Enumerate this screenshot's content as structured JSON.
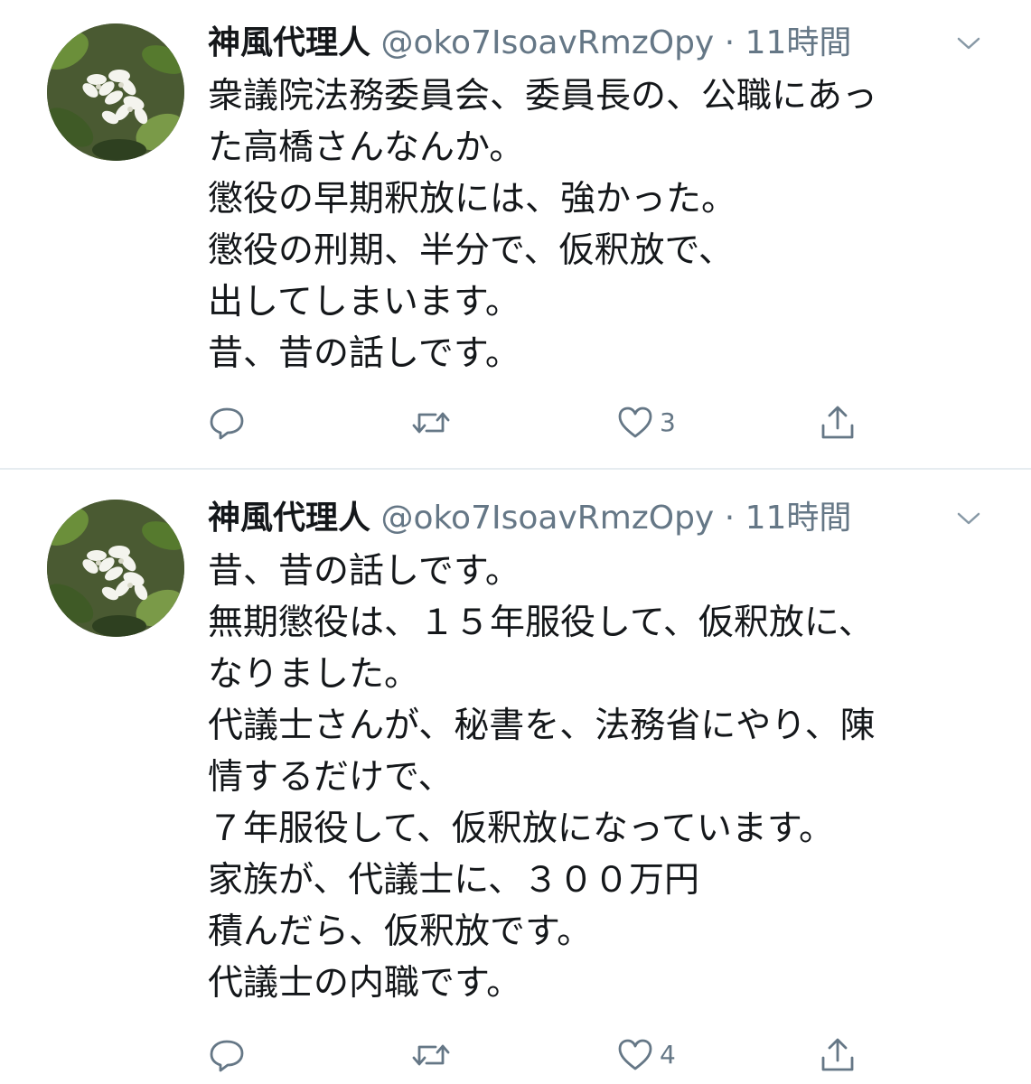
{
  "tweets": [
    {
      "display_name": "神風代理人",
      "handle": "@oko7IsoavRmzOpy",
      "separator": "·",
      "time": "11時間",
      "avatar_icon": "flower-avatar-icon",
      "lines": [
        "衆議院法務委員会、委員長の、公職にあっ",
        "た高橋さんなんか。",
        "懲役の早期釈放には、強かった。",
        "懲役の刑期、半分で、仮釈放で、",
        "出してしまいます。",
        "昔、昔の話しです。"
      ],
      "actions": {
        "reply_icon": "reply-icon",
        "retweet_icon": "retweet-icon",
        "like_icon": "heart-icon",
        "like_count": "3",
        "share_icon": "share-icon"
      }
    },
    {
      "display_name": "神風代理人",
      "handle": "@oko7IsoavRmzOpy",
      "separator": "·",
      "time": "11時間",
      "avatar_icon": "flower-avatar-icon",
      "lines": [
        "昔、昔の話しです。",
        "無期懲役は、１５年服役して、仮釈放に、",
        "なりました。",
        "代議士さんが、秘書を、法務省にやり、陳",
        "情するだけで、",
        "７年服役して、仮釈放になっています。",
        "家族が、代議士に、３００万円",
        "積んだら、仮釈放です。",
        "代議士の内職です。"
      ],
      "actions": {
        "reply_icon": "reply-icon",
        "retweet_icon": "retweet-icon",
        "like_icon": "heart-icon",
        "like_count": "4",
        "share_icon": "share-icon"
      }
    }
  ],
  "colors": {
    "text_primary": "#14171a",
    "text_secondary": "#657786",
    "divider": "#e6ecf0",
    "background": "#ffffff"
  }
}
